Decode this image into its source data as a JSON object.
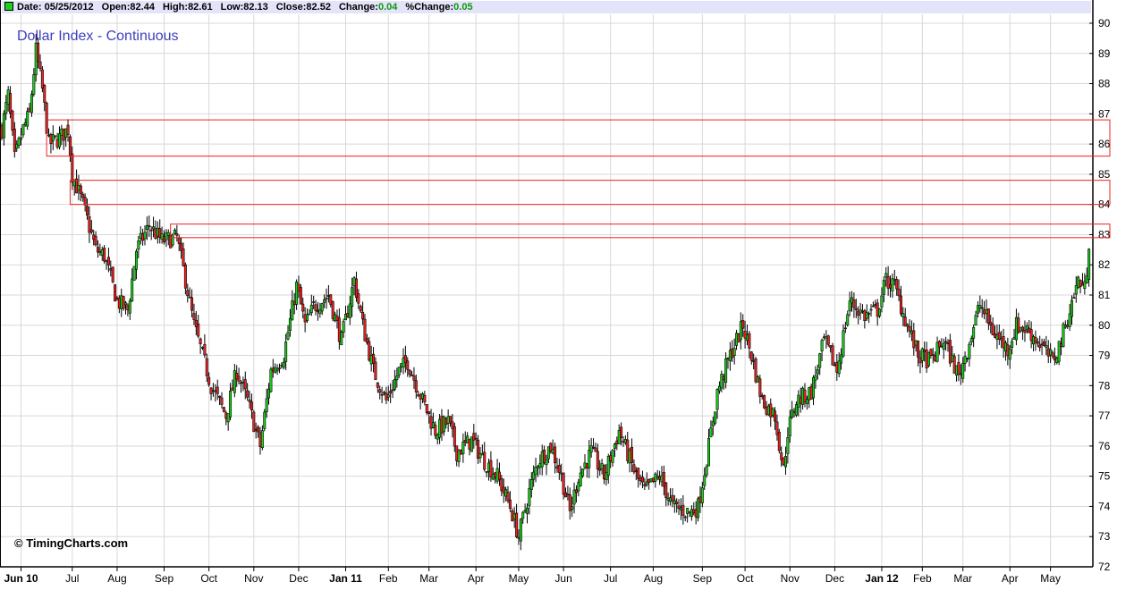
{
  "header": {
    "date_label": "Date:",
    "date": "05/25/2012",
    "open_label": "Open:",
    "open": "82.44",
    "high_label": "High:",
    "high": "82.61",
    "low_label": "Low:",
    "low": "82.13",
    "close_label": "Close:",
    "close": "82.52",
    "change_label": "Change:",
    "change": "0.04",
    "pct_change_label": "%Change:",
    "pct_change": "0.05"
  },
  "copyright": "© TimingCharts.com",
  "colors": {
    "up": "#1bd11b",
    "down": "#ee2222",
    "title": "#3e3ebf",
    "box": "#ee2222",
    "grid": "#d8d8d8",
    "header_bg": "#e3e3fa"
  },
  "chart_data": {
    "type": "candlestick",
    "title": "Dollar Index - Continuous",
    "ylim": [
      72,
      90.6
    ],
    "y_ticks": [
      72,
      73,
      74,
      75,
      76,
      77,
      78,
      79,
      80,
      81,
      82,
      83,
      84,
      85,
      86,
      87,
      88,
      89,
      90
    ],
    "total_bars": 510,
    "x_ticks": [
      {
        "label": "Jun 10",
        "bar": 9,
        "bold": true
      },
      {
        "label": "Jul",
        "bar": 33
      },
      {
        "label": "Aug",
        "bar": 54
      },
      {
        "label": "Sep",
        "bar": 76
      },
      {
        "label": "Oct",
        "bar": 97
      },
      {
        "label": "Nov",
        "bar": 118
      },
      {
        "label": "Dec",
        "bar": 139
      },
      {
        "label": "Jan 11",
        "bar": 161,
        "bold": true
      },
      {
        "label": "Feb",
        "bar": 181
      },
      {
        "label": "Mar",
        "bar": 200
      },
      {
        "label": "Apr",
        "bar": 222
      },
      {
        "label": "May",
        "bar": 242
      },
      {
        "label": "Jun",
        "bar": 263
      },
      {
        "label": "Jul",
        "bar": 285
      },
      {
        "label": "Aug",
        "bar": 305
      },
      {
        "label": "Sep",
        "bar": 328
      },
      {
        "label": "Oct",
        "bar": 348
      },
      {
        "label": "Nov",
        "bar": 369
      },
      {
        "label": "Dec",
        "bar": 390
      },
      {
        "label": "Jan 12",
        "bar": 412,
        "bold": true
      },
      {
        "label": "Feb",
        "bar": 431
      },
      {
        "label": "Mar",
        "bar": 450
      },
      {
        "label": "Apr",
        "bar": 472
      },
      {
        "label": "May",
        "bar": 491
      }
    ],
    "close_path": [
      [
        0,
        86.5
      ],
      [
        3,
        87.6
      ],
      [
        6,
        85.5
      ],
      [
        10,
        86.5
      ],
      [
        13,
        87
      ],
      [
        16,
        89.1
      ],
      [
        19,
        87.8
      ],
      [
        22,
        86
      ],
      [
        27,
        86.2
      ],
      [
        31,
        86.5
      ],
      [
        33,
        85
      ],
      [
        38,
        84
      ],
      [
        42,
        83
      ],
      [
        44,
        82.5
      ],
      [
        48,
        82.3
      ],
      [
        54,
        80.8
      ],
      [
        59,
        80.5
      ],
      [
        63,
        82.5
      ],
      [
        69,
        83.3
      ],
      [
        75,
        82.8
      ],
      [
        82,
        82.9
      ],
      [
        86,
        81.5
      ],
      [
        90,
        80
      ],
      [
        94,
        79
      ],
      [
        98,
        78
      ],
      [
        105,
        77
      ],
      [
        110,
        78.5
      ],
      [
        115,
        77.5
      ],
      [
        121,
        76
      ],
      [
        126,
        78.5
      ],
      [
        132,
        79
      ],
      [
        138,
        81.3
      ],
      [
        142,
        80
      ],
      [
        146,
        80.6
      ],
      [
        153,
        81
      ],
      [
        159,
        79.5
      ],
      [
        165,
        81.5
      ],
      [
        169,
        80
      ],
      [
        174,
        78.5
      ],
      [
        180,
        77.5
      ],
      [
        186,
        78.5
      ],
      [
        190,
        78.8
      ],
      [
        197,
        77.5
      ],
      [
        203,
        76.5
      ],
      [
        209,
        76.8
      ],
      [
        213,
        75.8
      ],
      [
        220,
        76.2
      ],
      [
        226,
        75.5
      ],
      [
        232,
        75
      ],
      [
        238,
        74
      ],
      [
        242,
        73
      ],
      [
        247,
        74.5
      ],
      [
        251,
        75.5
      ],
      [
        257,
        76
      ],
      [
        262,
        75
      ],
      [
        266,
        73.8
      ],
      [
        270,
        75
      ],
      [
        276,
        75.8
      ],
      [
        282,
        75
      ],
      [
        289,
        76.5
      ],
      [
        297,
        75
      ],
      [
        301,
        74.5
      ],
      [
        308,
        75
      ],
      [
        314,
        74
      ],
      [
        322,
        73.8
      ],
      [
        326,
        74
      ],
      [
        331,
        76
      ],
      [
        335,
        77.8
      ],
      [
        341,
        79
      ],
      [
        347,
        80
      ],
      [
        351,
        79
      ],
      [
        356,
        77.5
      ],
      [
        362,
        77
      ],
      [
        366,
        75.2
      ],
      [
        368,
        76.5
      ],
      [
        372,
        77.5
      ],
      [
        379,
        77.8
      ],
      [
        385,
        79.5
      ],
      [
        391,
        78.5
      ],
      [
        397,
        80.8
      ],
      [
        404,
        80.3
      ],
      [
        410,
        80.5
      ],
      [
        414,
        81.5
      ],
      [
        418,
        81.3
      ],
      [
        423,
        80.2
      ],
      [
        429,
        79
      ],
      [
        435,
        78.8
      ],
      [
        441,
        79.5
      ],
      [
        448,
        78.3
      ],
      [
        452,
        79.2
      ],
      [
        458,
        80.7
      ],
      [
        464,
        79.8
      ],
      [
        471,
        79.2
      ],
      [
        475,
        80
      ],
      [
        481,
        79.8
      ],
      [
        487,
        79.3
      ],
      [
        492,
        78.8
      ],
      [
        496,
        79.5
      ],
      [
        500,
        80.5
      ],
      [
        504,
        81.5
      ],
      [
        507,
        81.2
      ],
      [
        509,
        82.52
      ]
    ],
    "zones": [
      {
        "top": 86.8,
        "bottom": 85.6,
        "start_bar": 21
      },
      {
        "top": 84.8,
        "bottom": 84.0,
        "start_bar": 32
      },
      {
        "top": 83.35,
        "bottom": 82.9,
        "start_bar": 79
      }
    ]
  }
}
